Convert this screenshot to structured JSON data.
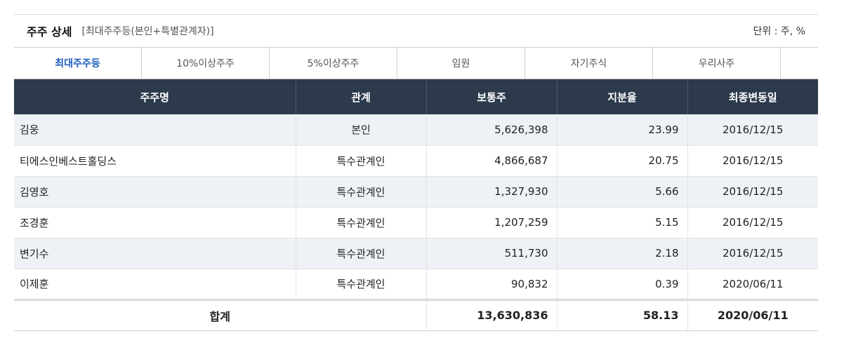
{
  "header": {
    "title": "주주 상세",
    "subtitle": "[최대주주등(본인+특별관계자)]",
    "unit": "단위 : 주, %"
  },
  "tabs": [
    {
      "label": "최대주주등",
      "active": true
    },
    {
      "label": "10%이상주주",
      "active": false
    },
    {
      "label": "5%이상주주",
      "active": false
    },
    {
      "label": "임원",
      "active": false
    },
    {
      "label": "자기주식",
      "active": false
    },
    {
      "label": "우리사주",
      "active": false
    }
  ],
  "table": {
    "columns": [
      "주주명",
      "관계",
      "보통주",
      "지분율",
      "최종변동일"
    ],
    "rows": [
      {
        "name": "김웅",
        "relation": "본인",
        "shares": "5,626,398",
        "ratio": "23.99",
        "date": "2016/12/15"
      },
      {
        "name": "티에스인베스트홀딩스",
        "relation": "특수관계인",
        "shares": "4,866,687",
        "ratio": "20.75",
        "date": "2016/12/15"
      },
      {
        "name": "김영호",
        "relation": "특수관계인",
        "shares": "1,327,930",
        "ratio": "5.66",
        "date": "2016/12/15"
      },
      {
        "name": "조경훈",
        "relation": "특수관계인",
        "shares": "1,207,259",
        "ratio": "5.15",
        "date": "2016/12/15"
      },
      {
        "name": "변기수",
        "relation": "특수관계인",
        "shares": "511,730",
        "ratio": "2.18",
        "date": "2016/12/15"
      },
      {
        "name": "이제훈",
        "relation": "특수관계인",
        "shares": "90,832",
        "ratio": "0.39",
        "date": "2020/06/11"
      }
    ],
    "total": {
      "label": "합계",
      "shares": "13,630,836",
      "ratio": "58.13",
      "date": "2020/06/11"
    }
  },
  "colors": {
    "header_bg": "#2c3a4c",
    "active_tab": "#1f5fbf",
    "alt_row": "#eef1f6"
  }
}
